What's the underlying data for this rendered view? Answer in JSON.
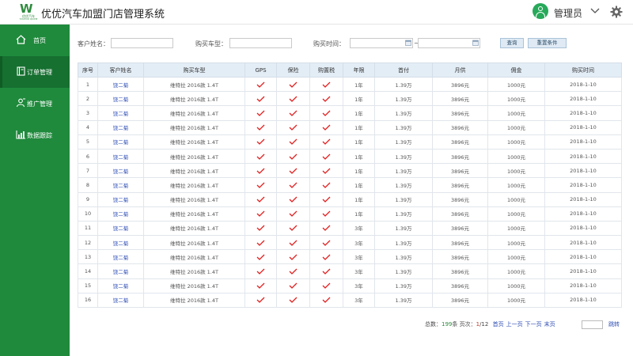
{
  "header": {
    "logo_mark": "W",
    "logo_text": "优优汽车",
    "logo_subtext": "YOUYOU QICHE",
    "app_title": "优优汽车加盟门店管理系统",
    "user_name": "管理员"
  },
  "sidebar": {
    "items": [
      {
        "label": "首页",
        "icon": "home-icon"
      },
      {
        "label": "订单管理",
        "icon": "order-icon"
      },
      {
        "label": "推广管理",
        "icon": "promote-icon"
      },
      {
        "label": "数据跟踪",
        "icon": "chart-icon"
      }
    ]
  },
  "filters": {
    "customer_label": "客户姓名：",
    "customer_value": "",
    "car_label": "购买车型：",
    "car_value": "",
    "time_label": "购买时间：",
    "date_from": "",
    "date_sep": "~",
    "date_to": "",
    "query_button": "查询",
    "reset_button": "重置条件"
  },
  "table": {
    "headers": [
      "序号",
      "客户姓名",
      "购买车型",
      "GPS",
      "保险",
      "购置税",
      "年限",
      "首付",
      "月供",
      "佣金",
      "购买时间"
    ],
    "rows": [
      {
        "no": "1",
        "name": "饶二菊",
        "model": "维特拉 2016款 1.4T",
        "years": "1年",
        "down": "1.39万",
        "monthly": "3896元",
        "commission": "1000元",
        "date": "2018-1-10"
      },
      {
        "no": "2",
        "name": "饶二菊",
        "model": "维特拉 2016款 1.4T",
        "years": "1年",
        "down": "1.39万",
        "monthly": "3896元",
        "commission": "1000元",
        "date": "2018-1-10"
      },
      {
        "no": "3",
        "name": "饶二菊",
        "model": "维特拉 2016款 1.4T",
        "years": "1年",
        "down": "1.39万",
        "monthly": "3896元",
        "commission": "1000元",
        "date": "2018-1-10"
      },
      {
        "no": "4",
        "name": "饶二菊",
        "model": "维特拉 2016款 1.4T",
        "years": "1年",
        "down": "1.39万",
        "monthly": "3896元",
        "commission": "1000元",
        "date": "2018-1-10"
      },
      {
        "no": "5",
        "name": "饶二菊",
        "model": "维特拉 2016款 1.4T",
        "years": "1年",
        "down": "1.39万",
        "monthly": "3896元",
        "commission": "1000元",
        "date": "2018-1-10"
      },
      {
        "no": "6",
        "name": "饶二菊",
        "model": "维特拉 2016款 1.4T",
        "years": "1年",
        "down": "1.39万",
        "monthly": "3896元",
        "commission": "1000元",
        "date": "2018-1-10"
      },
      {
        "no": "7",
        "name": "饶二菊",
        "model": "维特拉 2016款 1.4T",
        "years": "1年",
        "down": "1.39万",
        "monthly": "3896元",
        "commission": "1000元",
        "date": "2018-1-10"
      },
      {
        "no": "8",
        "name": "饶二菊",
        "model": "维特拉 2016款 1.4T",
        "years": "1年",
        "down": "1.39万",
        "monthly": "3896元",
        "commission": "1000元",
        "date": "2018-1-10"
      },
      {
        "no": "9",
        "name": "饶二菊",
        "model": "维特拉 2016款 1.4T",
        "years": "1年",
        "down": "1.39万",
        "monthly": "3896元",
        "commission": "1000元",
        "date": "2018-1-10"
      },
      {
        "no": "10",
        "name": "饶二菊",
        "model": "维特拉 2016款 1.4T",
        "years": "1年",
        "down": "1.39万",
        "monthly": "3896元",
        "commission": "1000元",
        "date": "2018-1-10"
      },
      {
        "no": "11",
        "name": "饶二菊",
        "model": "维特拉 2016款 1.4T",
        "years": "3年",
        "down": "1.39万",
        "monthly": "3896元",
        "commission": "1000元",
        "date": "2018-1-10"
      },
      {
        "no": "12",
        "name": "饶二菊",
        "model": "维特拉 2016款 1.4T",
        "years": "3年",
        "down": "1.39万",
        "monthly": "3896元",
        "commission": "1000元",
        "date": "2018-1-10"
      },
      {
        "no": "13",
        "name": "饶二菊",
        "model": "维特拉 2016款 1.4T",
        "years": "3年",
        "down": "1.39万",
        "monthly": "3896元",
        "commission": "1000元",
        "date": "2018-1-10"
      },
      {
        "no": "14",
        "name": "饶二菊",
        "model": "维特拉 2016款 1.4T",
        "years": "3年",
        "down": "1.39万",
        "monthly": "3896元",
        "commission": "1000元",
        "date": "2018-1-10"
      },
      {
        "no": "15",
        "name": "饶二菊",
        "model": "维特拉 2016款 1.4T",
        "years": "3年",
        "down": "1.39万",
        "monthly": "3896元",
        "commission": "1000元",
        "date": "2018-1-10"
      },
      {
        "no": "16",
        "name": "饶二菊",
        "model": "维特拉 2016款 1.4T",
        "years": "3年",
        "down": "1.39万",
        "monthly": "3896元",
        "commission": "1000元",
        "date": "2018-1-10"
      }
    ]
  },
  "pagination": {
    "total_label": "总数：",
    "total_count": "199",
    "total_unit": "条",
    "page_label": "页次：",
    "current_page": "1",
    "total_pages": "/12",
    "first": "首页",
    "prev": "上一页",
    "next": "下一页",
    "last": "末页",
    "jump_value": "",
    "jump": "跳转"
  },
  "colors": {
    "brand_green": "#1f8a3c",
    "sidebar_active": "#167030",
    "check_red": "#e02020",
    "link_blue": "#2b4bb3",
    "header_bg": "#e3edf6"
  }
}
